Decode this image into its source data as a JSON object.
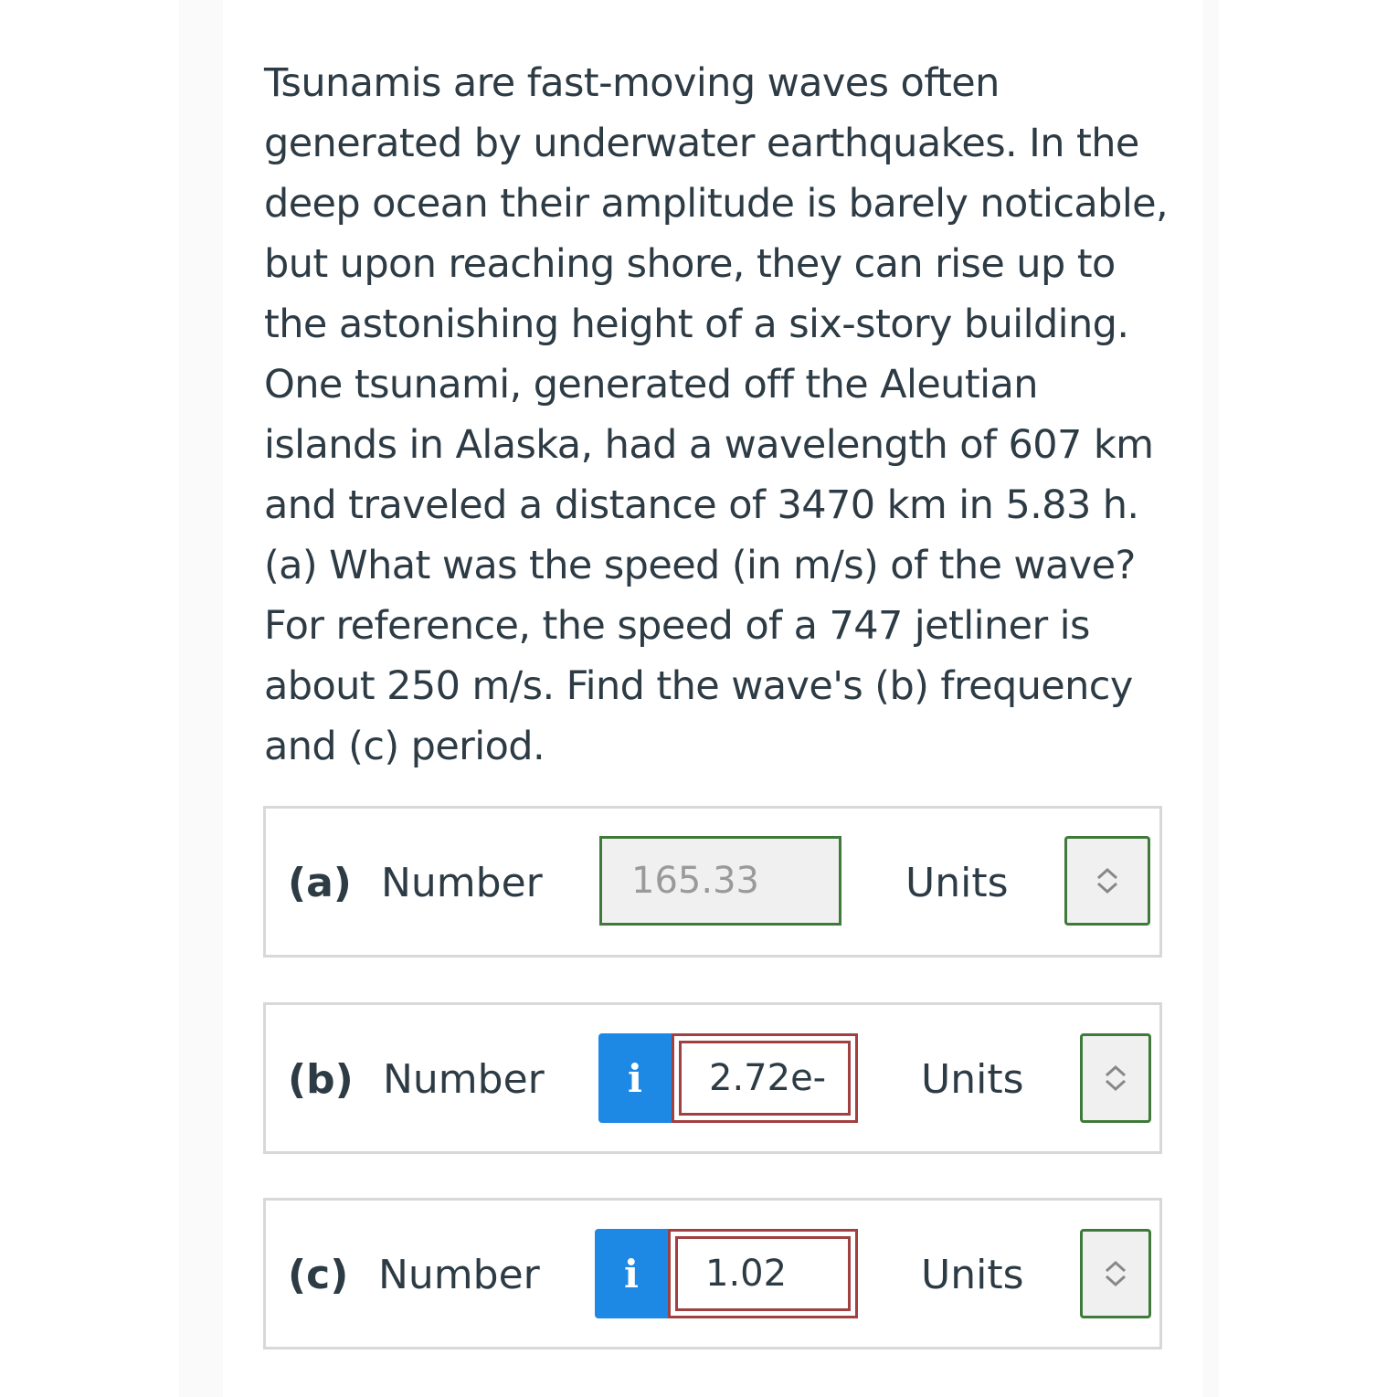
{
  "question": {
    "text": "Tsunamis are fast-moving waves often generated by underwater earthquakes. In the deep ocean their amplitude is barely noticable, but upon reaching shore, they can rise up to the astonishing height of a six-story building. One tsunami, generated off the Aleutian islands in Alaska, had a wavelength of 607 km and traveled a distance of 3470 km in 5.83 h. (a) What was the speed (in m/s) of the wave? For reference, the speed of a 747 jetliner is about 250 m/s. Find the wave's (b) frequency and (c) period."
  },
  "parts": [
    {
      "label": "(a)",
      "number_label": "Number",
      "value": "165.33",
      "units_label": "Units",
      "status": "correct"
    },
    {
      "label": "(b)",
      "number_label": "Number",
      "info_icon": "i",
      "value": "2.72e-",
      "units_label": "Units",
      "status": "incorrect"
    },
    {
      "label": "(c)",
      "number_label": "Number",
      "info_icon": "i",
      "value": "1.02",
      "units_label": "Units",
      "status": "incorrect"
    }
  ],
  "colors": {
    "correct_border": "#3f7a3a",
    "incorrect_border": "#a04040",
    "info_button": "#1e88e5",
    "text": "#2d3b45"
  }
}
